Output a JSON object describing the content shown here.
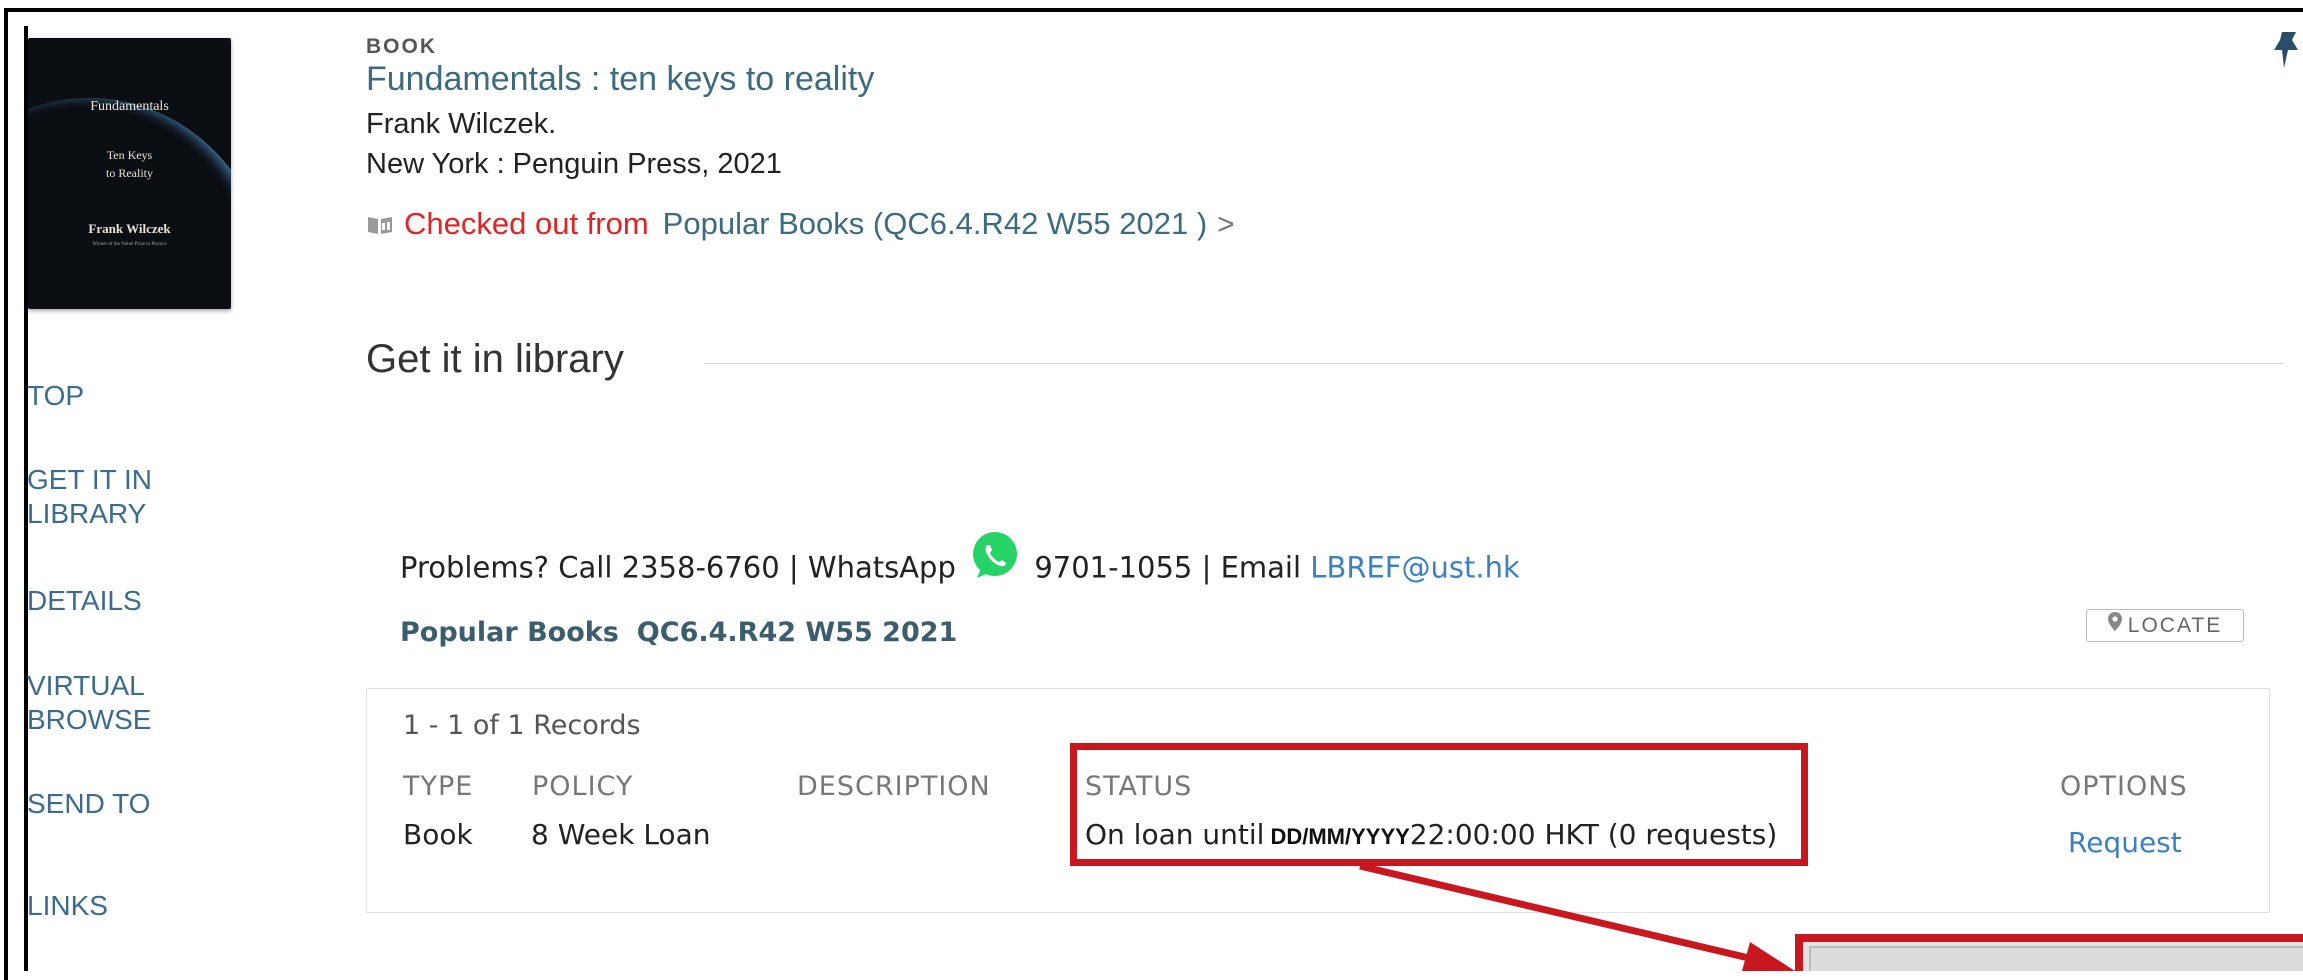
{
  "record": {
    "type_label": "BOOK",
    "title": "Fundamentals : ten keys to reality",
    "author": "Frank Wilczek.",
    "publication": "New York : Penguin Press, 2021",
    "availability_status": "Checked out from",
    "availability_location": "Popular Books (QC6.4.R42 W55 2021 )",
    "availability_chevron": ">"
  },
  "cover": {
    "line1": "Fundamentals",
    "line2": "Ten Keys",
    "line3": "to Reality",
    "line4": "Frank Wilczek",
    "line5": "Winner of the Nobel Prize in Physics"
  },
  "nav": {
    "items": [
      {
        "label": "TOP"
      },
      {
        "label": "GET IT IN\nLIBRARY"
      },
      {
        "label": "DETAILS"
      },
      {
        "label": "VIRTUAL\nBROWSE"
      },
      {
        "label": "SEND TO"
      },
      {
        "label": "LINKS"
      }
    ]
  },
  "get_it": {
    "section_title": "Get it in library",
    "problems_prefix": "Problems? Call 2358-6760 | WhatsApp",
    "problems_whatsapp": "9701-1055 | Email",
    "problems_email": "LBREF@ust.hk",
    "holding_location": "Popular Books",
    "holding_callnumber": "QC6.4.R42 W55 2021",
    "locate_label": "LOCATE",
    "records_count": "1 - 1 of 1 Records",
    "columns": [
      "TYPE",
      "POLICY",
      "DESCRIPTION",
      "STATUS",
      "OPTIONS"
    ],
    "row": {
      "type": "Book",
      "policy": "8 Week Loan",
      "description": "",
      "status_prefix": "On loan until",
      "status_date": "DD/MM/YYYY",
      "status_suffix": "22:00:00 HKT (0 requests)",
      "option": "Request"
    }
  },
  "colors": {
    "accent_link": "#3b6b7e",
    "alert_red": "#e02424",
    "highlight_box": "#c8171e",
    "whatsapp_green": "#25d366"
  }
}
